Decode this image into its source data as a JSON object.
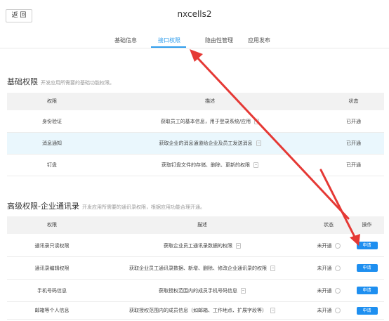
{
  "header": {
    "back_label": "返 回",
    "app_name": "nxcells2",
    "tabs": [
      {
        "label": "基础信息",
        "active": false
      },
      {
        "label": "接口权限",
        "active": true
      },
      {
        "label": "隐由性管理",
        "active": false
      },
      {
        "label": "应用发布",
        "active": false
      }
    ]
  },
  "basic": {
    "title": "基础权限",
    "subtitle": "开发应用所需要的基础功能权限。",
    "columns": {
      "permission": "权限",
      "description": "描述",
      "status": "状态"
    },
    "rows": [
      {
        "name": "身份验证",
        "description": "获取员工的基本信息，用于登录系统/应用",
        "status": "已开通",
        "highlighted": false
      },
      {
        "name": "消息通知",
        "description": "获取企业的消息通道给企业及员工发送消息",
        "status": "已开通",
        "highlighted": true
      },
      {
        "name": "钉盘",
        "description": "获取钉盘文件的存储、删除、更新的权限",
        "status": "已开通",
        "highlighted": false
      }
    ]
  },
  "advanced": {
    "title": "高级权限-企业通讯录",
    "subtitle": "开发应用所需要的通讯录权限，根据应用功能合理开通。",
    "columns": {
      "permission": "权限",
      "description": "描述",
      "status": "状态",
      "action": "操作"
    },
    "rows": [
      {
        "name": "通讯录只读权限",
        "description": "获取企业员工通讯录数据的权限",
        "status": "未开通",
        "action": "申请"
      },
      {
        "name": "通讯录编辑权限",
        "description": "获取企业员工通讯录数据、新增、删除、修改企业通讯录的权限",
        "status": "未开通",
        "action": "申请"
      },
      {
        "name": "手机号码信息",
        "description": "获取授权范围内的成员手机号码信息",
        "status": "未开通",
        "action": "申请"
      },
      {
        "name": "邮箱等个人信息",
        "description": "获取授权范围内的成员信息（如邮箱、工作地点、扩展字段等）",
        "status": "未开通",
        "action": "申请"
      }
    ]
  },
  "colors": {
    "accent": "#1e8ff0",
    "annotation": "#e53935",
    "highlight_row": "#eaf7fd"
  },
  "icons": [
    "doc-icon",
    "question-icon",
    "arrow-annotation"
  ]
}
